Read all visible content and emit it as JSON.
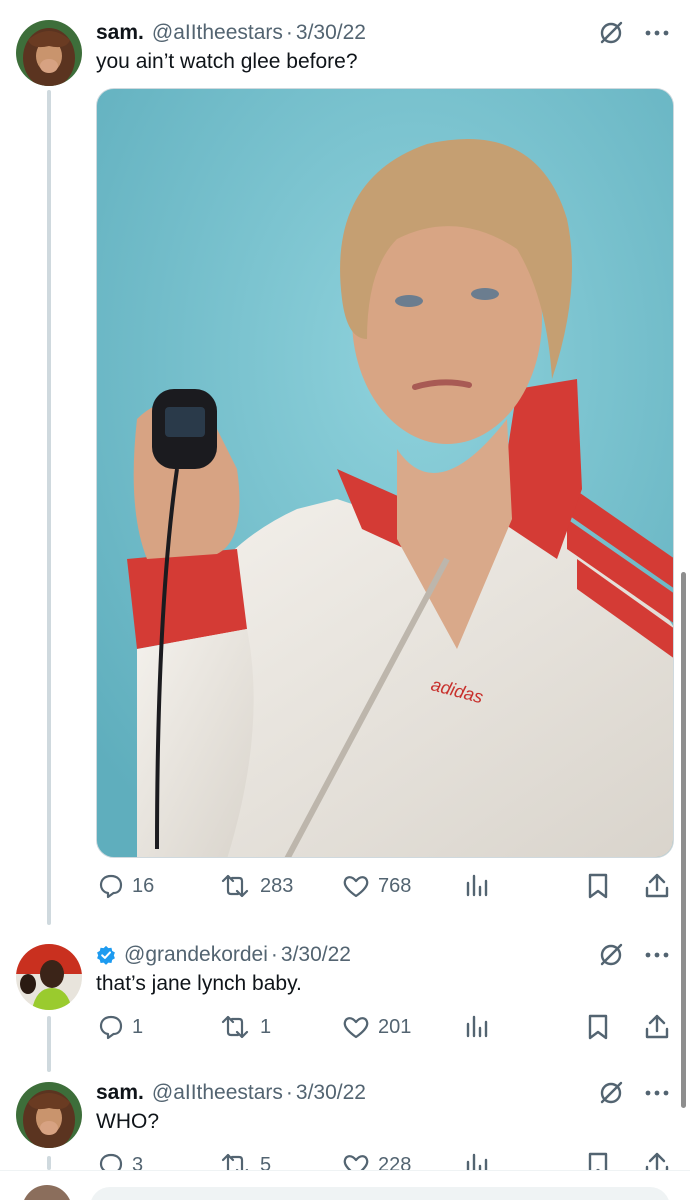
{
  "tweets": [
    {
      "name": "sam.",
      "handle": "@aIItheestars",
      "date": "3/30/22",
      "text": "you ain’t watch glee before?",
      "stats": {
        "replies": "16",
        "retweets": "283",
        "likes": "768"
      }
    },
    {
      "name": "",
      "handle": "@grandekordei",
      "date": "3/30/22",
      "verified": true,
      "text": "that’s jane lynch baby.",
      "stats": {
        "replies": "1",
        "retweets": "1",
        "likes": "201"
      }
    },
    {
      "name": "sam.",
      "handle": "@aIItheestars",
      "date": "3/30/22",
      "text": "WHO?",
      "stats": {
        "replies": "3",
        "retweets": "5",
        "likes": "228"
      }
    }
  ],
  "media": {
    "logo_text": "adidas"
  },
  "icons": {
    "reply": "reply-icon",
    "retweet": "retweet-icon",
    "like": "heart-icon",
    "views": "views-icon",
    "bookmark": "bookmark-icon",
    "share": "share-icon",
    "grok": "grok-icon",
    "more": "more-icon",
    "verified": "verified-badge-icon"
  },
  "colors": {
    "text": "#0f1419",
    "secondary": "#536471",
    "verified": "#1d9bf0",
    "thread_line": "#cfd9de",
    "media_bg": "#7ec3cf"
  }
}
